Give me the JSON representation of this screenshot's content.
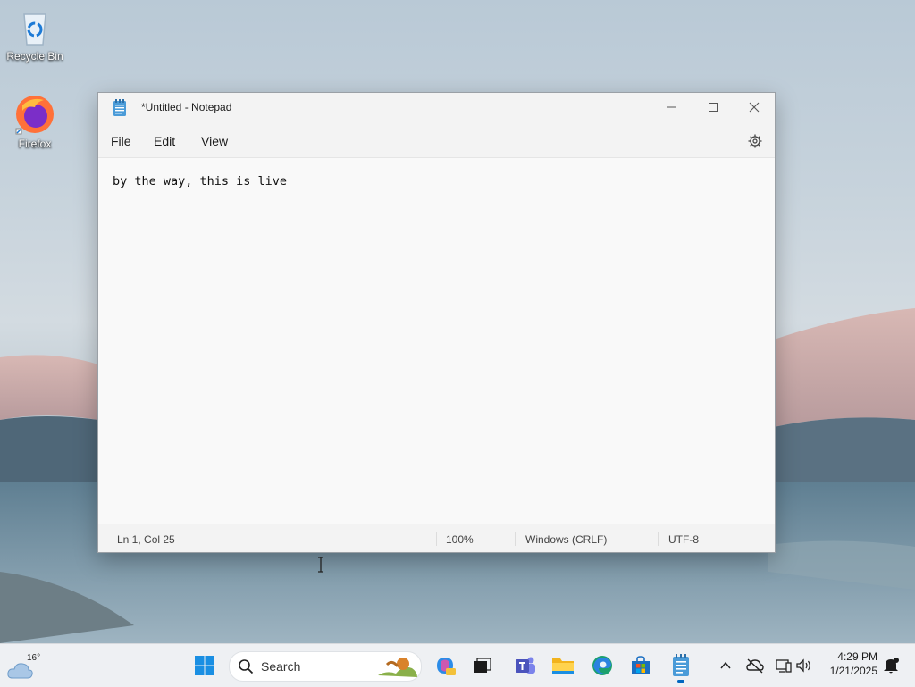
{
  "desktop": {
    "icons": [
      {
        "label": "Recycle Bin",
        "icon": "recycle-bin-icon"
      },
      {
        "label": "Firefox",
        "icon": "firefox-icon"
      }
    ]
  },
  "window": {
    "title": "*Untitled - Notepad",
    "controls": {
      "minimize": "minimize-icon",
      "maximize": "maximize-icon",
      "close": "close-icon"
    },
    "menu": [
      "File",
      "Edit",
      "View"
    ],
    "settings_icon": "gear-icon",
    "content": "by the way, this is live",
    "status": {
      "position": "Ln 1, Col 25",
      "zoom": "100%",
      "line_ending": "Windows (CRLF)",
      "encoding": "UTF-8"
    }
  },
  "taskbar": {
    "weather": {
      "temperature": "16°",
      "icon": "cloud-icon"
    },
    "search_label": "Search",
    "apps": [
      "start-icon",
      "copilot-icon",
      "task-view-icon",
      "teams-icon",
      "file-explorer-icon",
      "edge-icon",
      "store-icon",
      "notepad-icon"
    ],
    "tray": [
      "chevron-up-icon",
      "onedrive-icon",
      "network-icon",
      "volume-icon"
    ],
    "clock": {
      "time": "4:29 PM",
      "date": "1/21/2025"
    },
    "notification_icon": "notification-bell-icon"
  },
  "colors": {
    "accent": "#0067c0",
    "window_bg": "#f9f9f9",
    "taskbar_bg": "#eef0f3"
  }
}
